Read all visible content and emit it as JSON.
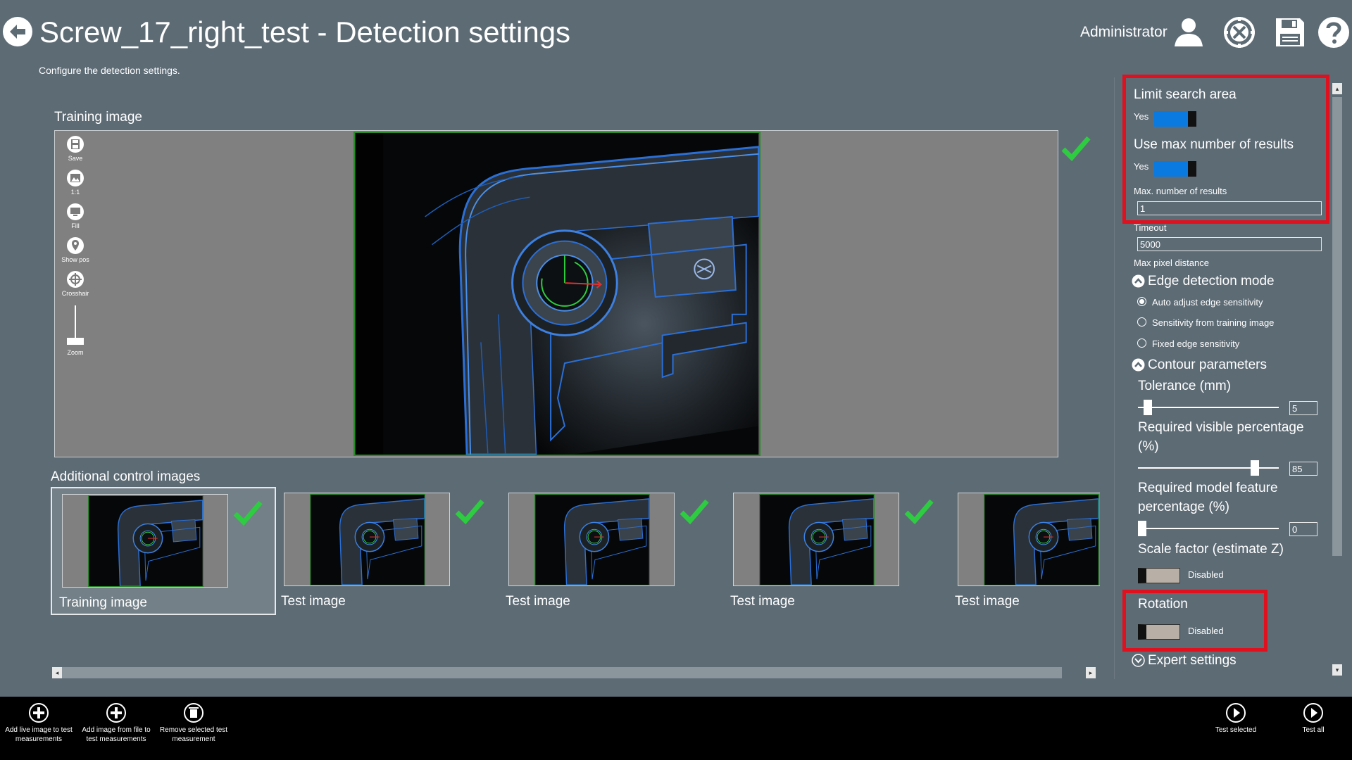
{
  "header": {
    "title": "Screw_17_right_test - Detection settings",
    "subtitle": "Configure the detection settings.",
    "user": "Administrator",
    "icons": [
      "back-arrow-icon",
      "user-icon",
      "tools-icon",
      "save-icon",
      "help-icon"
    ]
  },
  "training": {
    "title": "Training image",
    "toolbar": [
      {
        "label": "Save",
        "icon": "save-icon"
      },
      {
        "label": "1:1",
        "icon": "image-icon"
      },
      {
        "label": "Fill",
        "icon": "monitor-icon"
      },
      {
        "label": "Show pos",
        "icon": "pin-icon"
      },
      {
        "label": "Crosshair",
        "icon": "crosshair-icon"
      }
    ],
    "zoom_label": "Zoom"
  },
  "additional": {
    "title": "Additional control images",
    "items": [
      {
        "label": "Training image",
        "checked": true,
        "selected": true
      },
      {
        "label": "Test image",
        "checked": true,
        "selected": false
      },
      {
        "label": "Test image",
        "checked": true,
        "selected": false
      },
      {
        "label": "Test image",
        "checked": true,
        "selected": false
      },
      {
        "label": "Test image",
        "checked": false,
        "selected": false
      }
    ]
  },
  "settings": {
    "limit_search_area": {
      "label": "Limit search area",
      "state": "Yes"
    },
    "use_max_results": {
      "label": "Use max number of results",
      "state": "Yes"
    },
    "max_results": {
      "label": "Max. number of results",
      "value": "1"
    },
    "timeout": {
      "label": "Timeout",
      "value": "5000"
    },
    "max_pixel_distance": {
      "label": "Max pixel distance"
    },
    "edge_mode": {
      "label": "Edge detection mode",
      "options": [
        "Auto adjust edge sensitivity",
        "Sensitivity from training image",
        "Fixed edge sensitivity"
      ],
      "selected": 0
    },
    "contour": {
      "label": "Contour parameters",
      "tolerance": {
        "label": "Tolerance (mm)",
        "value": "5",
        "fraction": 0.04
      },
      "visible_pct": {
        "label_1": "Required visible percentage",
        "label_2": "(%)",
        "value": "85",
        "fraction": 0.85
      },
      "model_feature_pct": {
        "label_1": "Required model feature",
        "label_2": "percentage (%)",
        "value": "0",
        "fraction": 0.0
      }
    },
    "scale_factor": {
      "label": "Scale factor (estimate Z)",
      "state": "Disabled"
    },
    "rotation": {
      "label": "Rotation",
      "state": "Disabled"
    },
    "expert": {
      "label": "Expert settings"
    }
  },
  "bottom_bar": {
    "left": [
      {
        "label": "Add live image to test measurements",
        "icon": "add-circle-icon"
      },
      {
        "label": "Add image from file to test measurements",
        "icon": "add-circle-icon"
      },
      {
        "label": "Remove selected test measurement",
        "icon": "trash-icon"
      }
    ],
    "right": [
      {
        "label": "Test selected",
        "icon": "play-icon"
      },
      {
        "label": "Test all",
        "icon": "play-icon"
      }
    ]
  },
  "colors": {
    "background": "#5d6b75",
    "toggle_on": "#0a7ae0",
    "highlight": "#e0101e",
    "check": "#2ecc40"
  }
}
